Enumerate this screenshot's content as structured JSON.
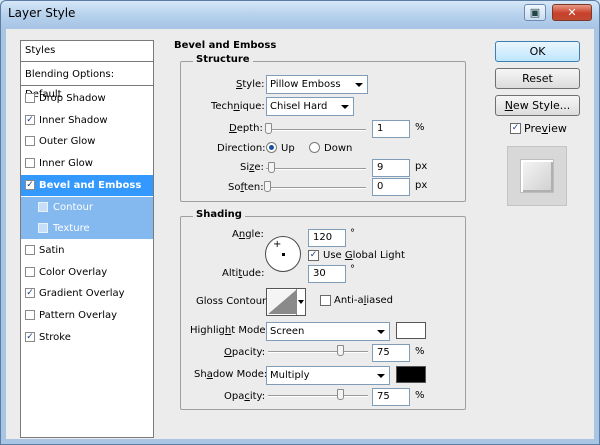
{
  "window": {
    "title": "Layer Style"
  },
  "styles_panel": {
    "header": "Styles",
    "blending": "Blending Options: Default",
    "items": [
      {
        "label": "Drop Shadow",
        "checked": false
      },
      {
        "label": "Inner Shadow",
        "checked": true
      },
      {
        "label": "Outer Glow",
        "checked": false
      },
      {
        "label": "Inner Glow",
        "checked": false
      },
      {
        "label": "Bevel and Emboss",
        "checked": true,
        "selected": true
      },
      {
        "label": "Contour",
        "checked": false,
        "sub": true
      },
      {
        "label": "Texture",
        "checked": false,
        "sub": true
      },
      {
        "label": "Satin",
        "checked": false
      },
      {
        "label": "Color Overlay",
        "checked": false
      },
      {
        "label": "Gradient Overlay",
        "checked": true
      },
      {
        "label": "Pattern Overlay",
        "checked": false
      },
      {
        "label": "Stroke",
        "checked": true
      }
    ]
  },
  "bevel": {
    "section_title": "Bevel and Emboss",
    "structure": {
      "group_title": "Structure",
      "style_label": "Style:",
      "style_value": "Pillow Emboss",
      "technique_label": "Technique:",
      "technique_value": "Chisel Hard",
      "depth_label": "Depth:",
      "depth_value": "1",
      "depth_unit": "%",
      "depth_slider_fraction": 0.01,
      "direction_label": "Direction:",
      "direction_up": "Up",
      "direction_down": "Down",
      "direction_selected": "Up",
      "size_label": "Size:",
      "size_value": "9",
      "size_unit": "px",
      "size_slider_fraction": 0.04,
      "soften_label": "Soften:",
      "soften_value": "0",
      "soften_unit": "px",
      "soften_slider_fraction": 0
    },
    "shading": {
      "group_title": "Shading",
      "angle_label": "Angle:",
      "angle_value": "120",
      "angle_unit": "°",
      "global_light_label": "Use Global Light",
      "global_light_checked": true,
      "altitude_label": "Altitude:",
      "altitude_value": "30",
      "altitude_unit": "°",
      "gloss_label": "Gloss Contour:",
      "anti_aliased_label": "Anti-aliased",
      "anti_aliased_checked": false,
      "highlight_mode_label": "Highlight Mode:",
      "highlight_mode_value": "Screen",
      "highlight_color": "#ffffff",
      "opacity_label": "Opacity:",
      "highlight_opacity_value": "75",
      "highlight_opacity_unit": "%",
      "highlight_opacity_fraction": 0.75,
      "shadow_mode_label": "Shadow Mode:",
      "shadow_mode_value": "Multiply",
      "shadow_color": "#000000",
      "shadow_opacity_value": "75",
      "shadow_opacity_unit": "%",
      "shadow_opacity_fraction": 0.75
    }
  },
  "buttons": {
    "ok": "OK",
    "reset": "Reset",
    "new_style": "New Style...",
    "preview_label": "Preview",
    "preview_checked": true
  }
}
